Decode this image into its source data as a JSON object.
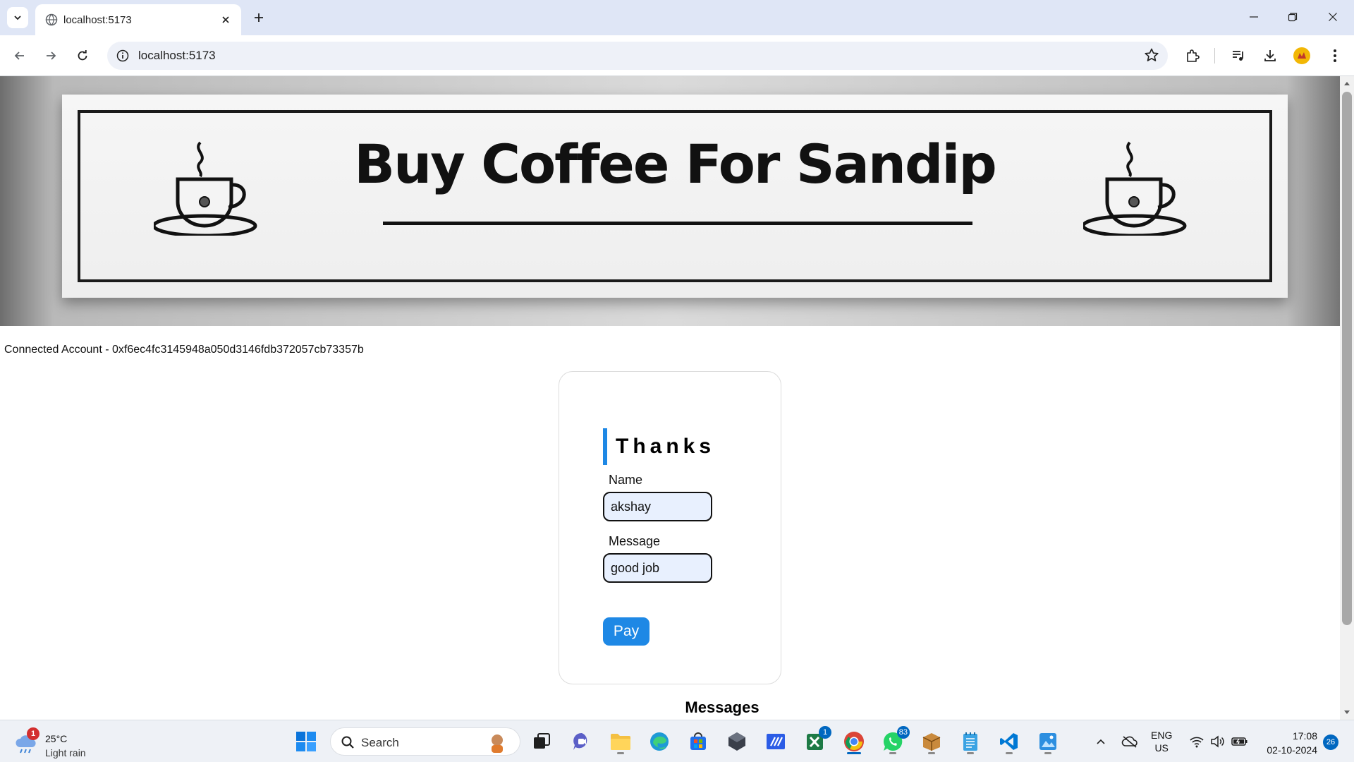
{
  "browser": {
    "tab_title": "localhost:5173",
    "url": "localhost:5173"
  },
  "banner": {
    "title": "Buy Coffee For Sandip"
  },
  "account": {
    "label": "Connected Account - ",
    "address": "0xf6ec4fc3145948a050d3146fdb372057cb73357b"
  },
  "form": {
    "heading": "Thanks",
    "name_label": "Name",
    "name_value": "akshay",
    "message_label": "Message",
    "message_value": "good job",
    "pay_label": "Pay"
  },
  "messages": {
    "heading": "Messages"
  },
  "taskbar": {
    "weather_temp": "25°C",
    "weather_desc": "Light rain",
    "weather_badge": "1",
    "search_placeholder": "Search",
    "excel_badge": "1",
    "whatsapp_badge": "83",
    "lang_1": "ENG",
    "lang_2": "US",
    "time": "17:08",
    "date": "02-10-2024",
    "notification_count": "26"
  },
  "colors": {
    "accent": "#1e88e5",
    "input_bg": "#e8f0fe",
    "chrome_tabbar": "#dfe6f6"
  }
}
